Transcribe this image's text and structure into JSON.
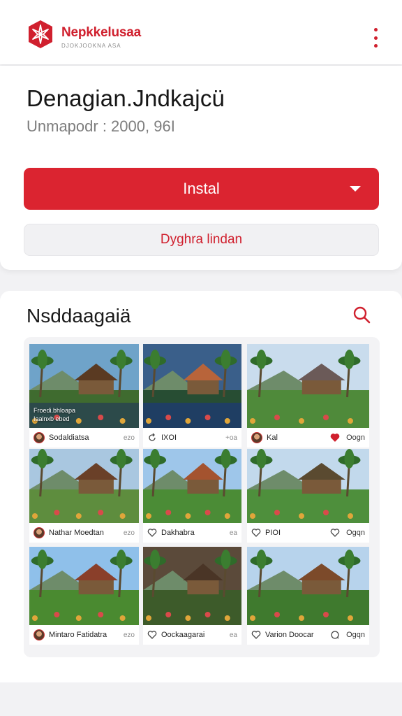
{
  "app": {
    "brand": "Nepkkelusaa",
    "brand_sub": "DJOKJOOKNA ASA",
    "colors": {
      "accent": "#db2430",
      "background": "#f2f2f4"
    }
  },
  "header": {
    "title": "Denagian.Jndkajcü",
    "subtitle": "Unmapodr : 2000, 96I"
  },
  "actions": {
    "install_label": "Instal",
    "secondary_label": "Dyghra lindan"
  },
  "gallery": {
    "title": "Nsddaagaiä",
    "tiles": [
      {
        "overlay": "Froedi.bhloapa",
        "overlay2": "Iaalnxb ebed",
        "name": "Sodaldiatsa",
        "right": "ezo",
        "lead": "avatar",
        "right_icon": ""
      },
      {
        "overlay": "",
        "overlay2": "",
        "name": "IXOI",
        "right": "+oa",
        "lead": "refresh",
        "right_icon": ""
      },
      {
        "overlay": "",
        "overlay2": "",
        "name": "Kal",
        "right": "Oogn",
        "lead": "avatar",
        "right_icon": "heart-filled"
      },
      {
        "overlay": "",
        "overlay2": "",
        "name": "Nathar Moedtan",
        "right": "ezo",
        "lead": "avatar",
        "right_icon": ""
      },
      {
        "overlay": "",
        "overlay2": "",
        "name": "Dakhabra",
        "right": "ea",
        "lead": "heart",
        "right_icon": ""
      },
      {
        "overlay": "",
        "overlay2": "",
        "name": "PIOI",
        "right": "Ogqn",
        "lead": "heart",
        "right_icon": "heart"
      },
      {
        "overlay": "",
        "overlay2": "",
        "name": "Mintaro Fatidatra",
        "right": "ezo",
        "lead": "avatar",
        "right_icon": ""
      },
      {
        "overlay": "",
        "overlay2": "",
        "name": "Oockaagarai",
        "right": "ea",
        "lead": "heart",
        "right_icon": ""
      },
      {
        "overlay": "",
        "overlay2": "",
        "name": "Varion Doocar",
        "right": "Ogqn",
        "lead": "heart",
        "right_icon": "chat"
      }
    ]
  }
}
